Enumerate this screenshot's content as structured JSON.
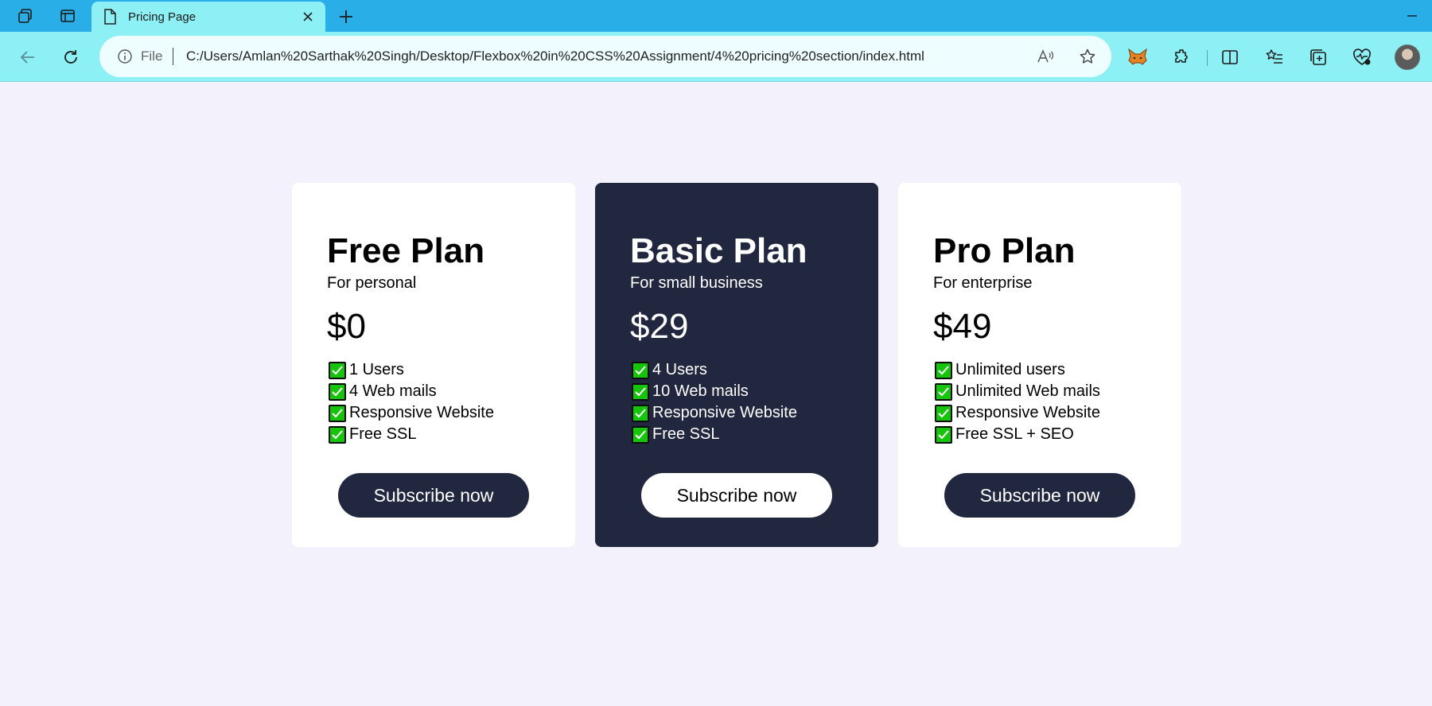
{
  "browser": {
    "tab_title": "Pricing Page",
    "address_scheme_label": "File",
    "url": "C:/Users/Amlan%20Sarthak%20Singh/Desktop/Flexbox%20in%20CSS%20Assignment/4%20pricing%20section/index.html",
    "tabbar_color": "#2aaee8",
    "toolbar_color": "#8df0f4",
    "icons": {
      "workspaces": "workspaces-icon",
      "tab_actions": "tab-actions-icon",
      "favicon": "page-icon",
      "close": "close-icon",
      "new_tab": "plus-icon",
      "minimize": "minimize-icon",
      "back": "back-arrow-icon",
      "refresh": "refresh-icon",
      "info": "info-icon",
      "read_aloud": "read-aloud-icon",
      "favorite": "star-icon",
      "extensions": [
        "metamask-fox-icon",
        "puzzle-extensions-icon",
        "split-screen-icon",
        "favorites-list-icon",
        "collections-icon",
        "browser-essentials-icon"
      ]
    }
  },
  "plans": [
    {
      "name": "Free Plan",
      "audience": "For personal",
      "price": "$0",
      "features": [
        "1 Users",
        "4 Web mails",
        "Responsive Website",
        "Free SSL"
      ],
      "cta": "Subscribe now",
      "theme": "light"
    },
    {
      "name": "Basic Plan",
      "audience": "For small business",
      "price": "$29",
      "features": [
        "4 Users",
        "10 Web mails",
        "Responsive Website",
        "Free SSL"
      ],
      "cta": "Subscribe now",
      "theme": "dark"
    },
    {
      "name": "Pro Plan",
      "audience": "For enterprise",
      "price": "$49",
      "features": [
        "Unlimited users",
        "Unlimited Web mails",
        "Responsive Website",
        "Free SSL + SEO"
      ],
      "cta": "Subscribe now",
      "theme": "light"
    }
  ],
  "colors": {
    "page_background": "#f3f2fc",
    "dark_card": "#222740",
    "check_green": "#15c40b"
  }
}
